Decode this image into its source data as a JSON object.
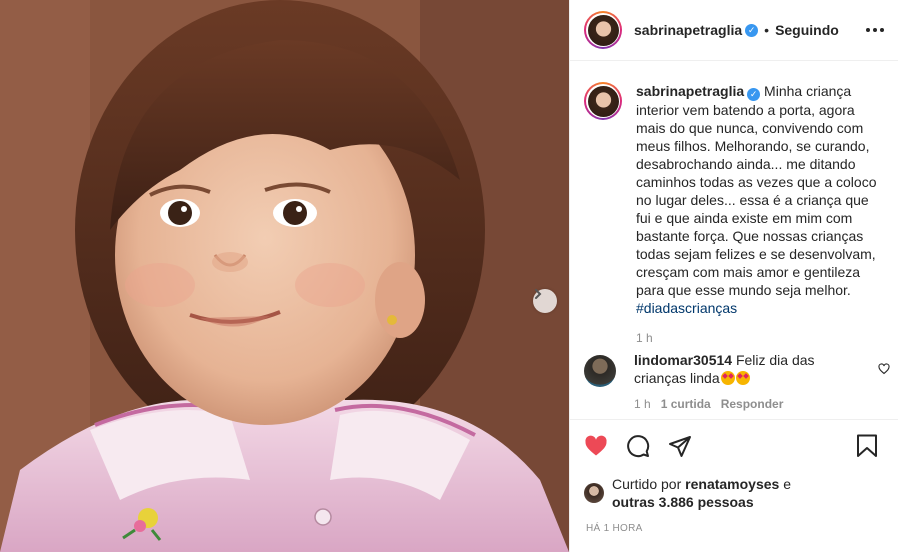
{
  "header": {
    "username": "sabrinapetraglia",
    "verified_mark": "✓",
    "separator": "•",
    "follow_state": "Seguindo"
  },
  "caption": {
    "username": "sabrinapetraglia",
    "text": " Minha criança interior vem batendo a porta, agora mais do que nunca, convivendo com meus filhos. Melhorando, se curando, desabrochando ainda... me ditando caminhos todas as vezes que a coloco no lugar deles... essa é a criança que fui e que ainda existe em mim com bastante força. Que nossas crianças todas sejam felizes e se desenvolvam, cresçam com mais amor e gentileza para que esse mundo seja melhor. ",
    "hashtag": "#diadascrianças",
    "time": "1 h"
  },
  "comments": [
    {
      "username": "lindomar30514",
      "text": " Feliz dia das crianças linda",
      "emoji": "star-struck",
      "time": "1 h",
      "likes": "1 curtida",
      "reply_label": "Responder"
    }
  ],
  "actions": {
    "like_icon": "heart-filled-icon",
    "comment_icon": "comment-icon",
    "share_icon": "share-icon",
    "save_icon": "bookmark-icon",
    "like_color": "#ed4956"
  },
  "likes": {
    "prefix": "Curtido por ",
    "user": "renatamoyses",
    "connector": " e",
    "others": "outras 3.886 pessoas"
  },
  "post_time": "HÁ 1 HORA"
}
